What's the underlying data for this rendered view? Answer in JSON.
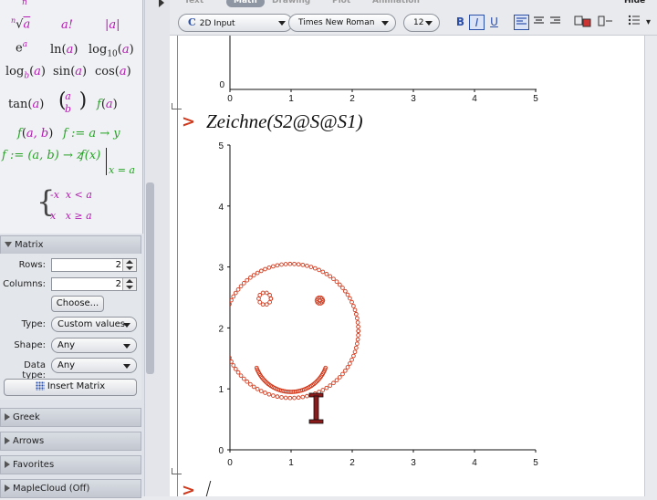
{
  "palette": {
    "row0": [
      "n",
      "a",
      "|a|"
    ],
    "row1": {
      "root": "a",
      "root_index": "n",
      "fact": "a!",
      "abs": "|a|"
    },
    "row2": {
      "exp": "e",
      "exp_sup": "a",
      "ln": "ln",
      "ln_arg": "a",
      "log10": "log",
      "log10_sub": "10",
      "log10_arg": "a"
    },
    "row3": {
      "logb": "log",
      "logb_sub": "b",
      "logb_arg": "a",
      "sin": "sin",
      "sin_arg": "a",
      "cos": "cos",
      "cos_arg": "a"
    },
    "row4": {
      "tan": "tan",
      "tan_arg": "a",
      "binom_top": "a",
      "binom_bot": "b",
      "fa": "f",
      "fa_arg": "a"
    },
    "row5": {
      "fab": "f",
      "fab_args": "a, b",
      "assign": "f := a → y"
    },
    "row6": {
      "fdef": "f := (a, b) → z",
      "fx": "f(x)",
      "eval_at": "x = a"
    },
    "piecewise": [
      {
        "expr": "-x",
        "cond": "x < a"
      },
      {
        "expr": "x",
        "cond": "x ≥ a"
      }
    ]
  },
  "matrix": {
    "title": "Matrix",
    "rows_label": "Rows:",
    "rows_value": "2",
    "cols_label": "Columns:",
    "cols_value": "2",
    "choose_label": "Choose...",
    "type_label": "Type:",
    "type_value": "Custom values",
    "shape_label": "Shape:",
    "shape_value": "Any",
    "datatype_label": "Data type:",
    "datatype_value": "Any",
    "insert_label": "Insert Matrix"
  },
  "sections": [
    "Greek",
    "Arrows",
    "Favorites",
    "MapleCloud (Off)"
  ],
  "toolbar": {
    "tabs": [
      "Text",
      "Math",
      "Drawing",
      "Plot",
      "Animation"
    ],
    "hide": "Hide",
    "input_mode": "2D Input",
    "font": "Times New Roman",
    "size": "12",
    "bold": "B",
    "italic": "I",
    "underline": "U"
  },
  "worksheet": {
    "prompt": ">",
    "command": "Zeichne(S2@S@S1)"
  },
  "chart_data": [
    {
      "type": "line",
      "note_visible": "top plot partially visible (only lower part shown)",
      "xticks": [
        "0",
        "1",
        "2",
        "3",
        "4",
        "5"
      ],
      "yticks_visible": [
        "0"
      ],
      "xlim": [
        0,
        5
      ]
    },
    {
      "type": "scatter",
      "xticks": [
        "0",
        "1",
        "2",
        "3",
        "4",
        "5"
      ],
      "yticks": [
        "0",
        "1",
        "2",
        "3",
        "4",
        "5"
      ],
      "xlim": [
        0,
        5
      ],
      "ylim": [
        0,
        5
      ],
      "color": "#d23a1d",
      "shapes": [
        {
          "name": "face-circle",
          "center": [
            1.0,
            1.95
          ],
          "radius": 1.1
        },
        {
          "name": "smile-arc",
          "center": [
            1.0,
            1.55
          ],
          "radius": 0.6,
          "angle_from": 200,
          "angle_to": 340
        },
        {
          "name": "left-eye",
          "center": [
            0.57,
            2.48
          ],
          "radius": 0.1
        },
        {
          "name": "right-eye",
          "center": [
            1.47,
            2.45
          ],
          "radius": 0.05
        }
      ]
    }
  ]
}
